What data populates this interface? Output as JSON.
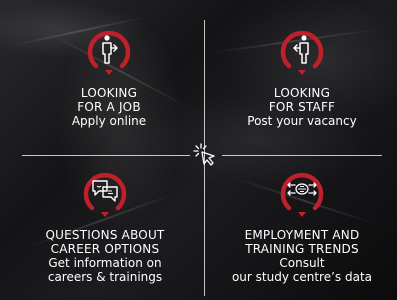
{
  "colors": {
    "accent": "#c0202a",
    "text": "#ffffff"
  },
  "center_icon": "cursor-click-icon",
  "tiles": [
    {
      "icon": "job-seeker-icon",
      "title_line1": "LOOKING",
      "title_line2": "FOR A JOB",
      "sub_line1": "Apply online",
      "sub_line2": ""
    },
    {
      "icon": "employer-icon",
      "title_line1": "LOOKING",
      "title_line2": "FOR STAFF",
      "sub_line1": "Post your vacancy",
      "sub_line2": ""
    },
    {
      "icon": "chat-bubbles-icon",
      "title_line1": "QUESTIONS ABOUT",
      "title_line2": "CAREER OPTIONS",
      "sub_line1": "Get information on",
      "sub_line2": "careers & trainings"
    },
    {
      "icon": "trends-arrows-icon",
      "title_line1": "EMPLOYMENT AND",
      "title_line2": "TRAINING TRENDS",
      "sub_line1": "Consult",
      "sub_line2": "our study centre’s data"
    }
  ]
}
